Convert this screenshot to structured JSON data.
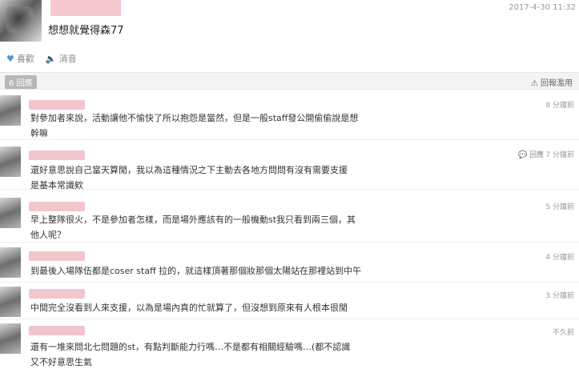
{
  "post": {
    "time": "2017-4-30 11:32",
    "text": "想想就覺得森77",
    "like_label": "喜歡",
    "mute_label": "消音"
  },
  "bar": {
    "reply_count": "6 回應",
    "report_label": "回報濫用"
  },
  "comments": [
    {
      "time": "8 分鐘前",
      "text": "對參加者來說，活動讓他不愉快了所以抱怨是當然，但是一般staff發公開偷偷說是想\n幹嘛"
    },
    {
      "time": "7 分鐘前",
      "reply_label": "回應",
      "text": "還好意思說自己當天算閒，我以為這種情況之下主動去各地方問問有沒有需要支援\n是基本常識欸"
    },
    {
      "time": "5 分鐘前",
      "text": "早上整隊很火，不是參加者怎樣，而是場外應該有的一般機動st我只看到兩三個，其\n他人呢？"
    },
    {
      "time": "4 分鐘前",
      "text": "到最後入場隊伍都是coser staff 拉的，就這樣頂著那個妝那個太陽站在那裡站到中午"
    },
    {
      "time": "3 分鐘前",
      "text": "中間完全沒看到人來支援，以為是場內真的忙就算了，但沒想到原來有人根本很閒"
    },
    {
      "time": "不久前",
      "text": "還有一堆來問北七問題的st，有點判斷能力行嗎…不是都有相關經驗嗎…(都不認識\n又不好意思生氣"
    }
  ]
}
